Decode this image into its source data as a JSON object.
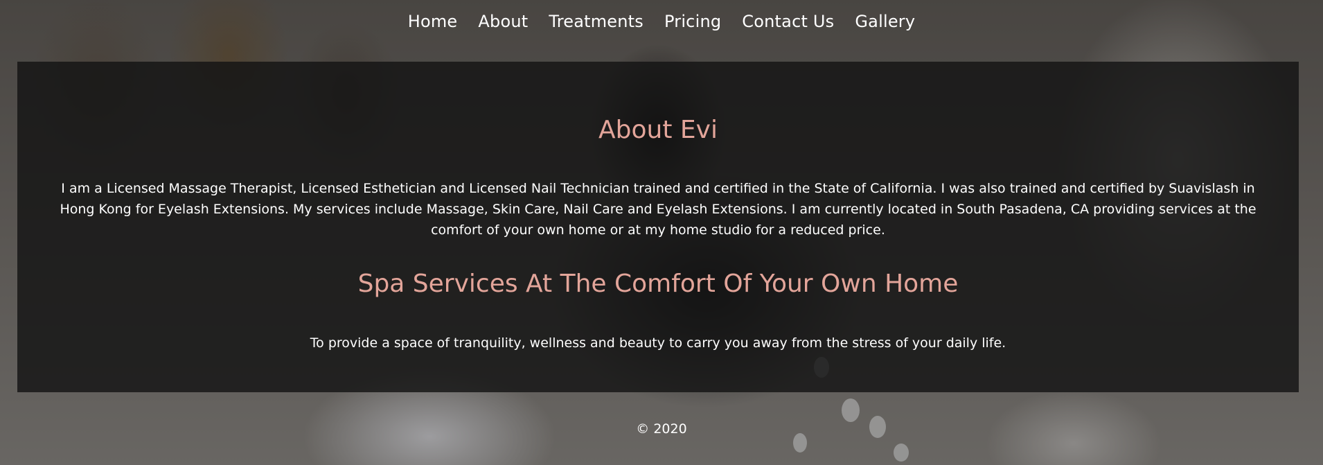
{
  "nav": {
    "items": [
      {
        "label": "Home"
      },
      {
        "label": "About"
      },
      {
        "label": "Treatments"
      },
      {
        "label": "Pricing"
      },
      {
        "label": "Contact Us"
      },
      {
        "label": "Gallery"
      }
    ]
  },
  "about": {
    "title": "About Evi",
    "text": "I am a Licensed Massage Therapist, Licensed Esthetician and Licensed Nail Technician trained and certified in the State of California. I was also trained and certified by Suavislash in Hong Kong for Eyelash Extensions. My services include Massage, Skin Care, Nail Care and Eyelash Extensions. I am currently located in South Pasadena, CA providing services at the comfort of your own home or at my home studio for a reduced price."
  },
  "services": {
    "title": "Spa Services At The Comfort Of Your Own Home",
    "text": "To provide a space of tranquility, wellness and beauty to carry you away from the stress of your daily life."
  },
  "footer": {
    "copyright": "© 2020"
  },
  "colors": {
    "heading_accent": "#e3a59a",
    "panel_background": "#141414",
    "text": "#ffffff"
  }
}
